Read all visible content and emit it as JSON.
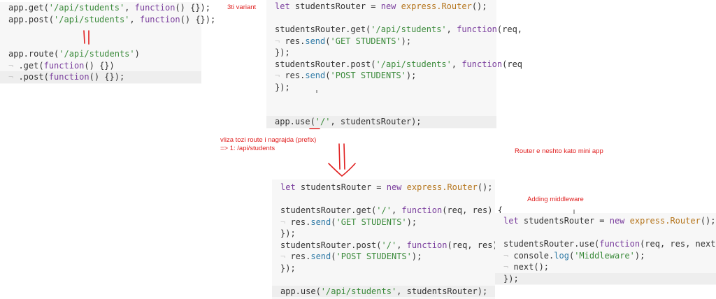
{
  "panel1": {
    "lines": [
      "app.get('/api/students', function() {});",
      "app.post('/api/students', function() {});",
      "",
      "",
      "app.route('/api/students')",
      "  .get(function() {})",
      "  .post(function() {});"
    ]
  },
  "panel2": {
    "lines": [
      "let studentsRouter = new express.Router();",
      "",
      "studentsRouter.get('/api/students', function(req,",
      "  res.send('GET STUDENTS');",
      "});",
      "studentsRouter.post('/api/students', function(req",
      "  res.send('POST STUDENTS');",
      "});",
      "",
      "",
      "app.use('/', studentsRouter);"
    ]
  },
  "panel3": {
    "lines": [
      "let studentsRouter = new express.Router();",
      "",
      "studentsRouter.get('/', function(req, res) {",
      "  res.send('GET STUDENTS');",
      "});",
      "studentsRouter.post('/', function(req, res) {",
      "  res.send('POST STUDENTS');",
      "});",
      "",
      "app.use('/api/students', studentsRouter);"
    ]
  },
  "panel4": {
    "lines": [
      "let studentsRouter = new express.Router();",
      "",
      "studentsRouter.use(function(req, res, next) {",
      "  console.log('Middleware');",
      "  next();",
      "});"
    ]
  },
  "notes": {
    "variant": "3ti variant",
    "prefix_line1": "vliza tozi route i nagrajda (prefix)",
    "prefix_line2": "=> 1: /api/students",
    "router_note": "Router e neshto kato mini app",
    "middleware_note": "Adding middleware"
  },
  "colors": {
    "keyword": "#7a3e9d",
    "class": "#b5751c",
    "string": "#3a8a3a",
    "method": "#2f7aa6",
    "annotation": "#e02020"
  }
}
